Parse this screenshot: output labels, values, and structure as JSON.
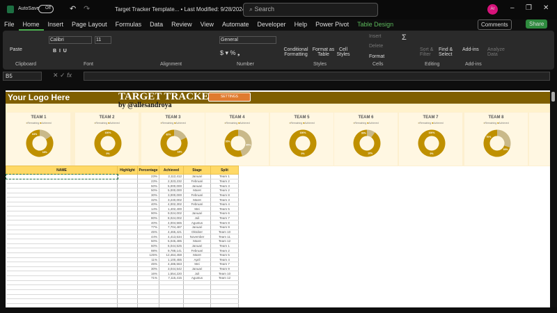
{
  "titlebar": {
    "autosave": "AutoSave",
    "toggle": "Off",
    "doc_title": "Target Tracker Template... • Last Modified: 9/28/2024",
    "search_placeholder": "Search",
    "avatar": "Ar"
  },
  "menu": [
    "File",
    "Home",
    "Insert",
    "Page Layout",
    "Formulas",
    "Data",
    "Review",
    "View",
    "Automate",
    "Developer",
    "Help",
    "Power Pivot",
    "Table Design"
  ],
  "comments": "Comments",
  "share": "Share",
  "ribbon": {
    "paste": "Paste",
    "font": "Calibri",
    "size": "11",
    "number_format": "General",
    "cond": "Conditional Formatting",
    "fmt_table": "Format as Table",
    "cell_styles": "Cell Styles",
    "insert": "Insert",
    "delete": "Delete",
    "format": "Format",
    "sort": "Sort & Filter",
    "find": "Find & Select",
    "addins": "Add-ins",
    "analyze": "Analyze Data",
    "groups": [
      "Clipboard",
      "Font",
      "Alignment",
      "Number",
      "Styles",
      "Cells",
      "Editing",
      "Add-ins"
    ]
  },
  "namebox": "B5",
  "sheet": {
    "logo": "Your Logo Here",
    "title": "TARGET TRACKER",
    "byline": "by @allesandroya",
    "settings": "SETTINGS",
    "legend_remaining": "Remaining",
    "legend_achieved": "Achieved",
    "colors": {
      "achieved": "#bf9000",
      "remaining": "#c9b98a"
    },
    "teams": [
      {
        "name": "TEAM 1",
        "remaining": 16,
        "achieved": 84
      },
      {
        "name": "TEAM 2",
        "remaining": 0,
        "achieved": 100
      },
      {
        "name": "TEAM 3",
        "remaining": 18,
        "achieved": 82
      },
      {
        "name": "TEAM 4",
        "remaining": 45,
        "achieved": 55
      },
      {
        "name": "TEAM 5",
        "remaining": 0,
        "achieved": 100
      },
      {
        "name": "TEAM 6",
        "remaining": 10,
        "achieved": 90
      },
      {
        "name": "TEAM 7",
        "remaining": 0,
        "achieved": 100
      },
      {
        "name": "TEAM 8",
        "remaining": 30,
        "achieved": 70
      }
    ],
    "headers": [
      "NAME",
      "Highlight",
      "Percentage",
      "Achieved",
      "Stage",
      "Split"
    ],
    "rows": [
      [
        "23%",
        "2,112,412",
        "Januari",
        "Team 1"
      ],
      [
        "23%",
        "2,323,232",
        "Februari",
        "Team 2"
      ],
      [
        "50%",
        "5,000,000",
        "Januari",
        "Team 3"
      ],
      [
        "50%",
        "5,000,000",
        "Maret",
        "Team 2"
      ],
      [
        "30%",
        "3,000,000",
        "Februari",
        "Team 8"
      ],
      [
        "32%",
        "3,240,002",
        "Maret",
        "Team 3"
      ],
      [
        "40%",
        "4,002,302",
        "Februari",
        "Team 4"
      ],
      [
        "14%",
        "1,402,400",
        "Mei",
        "Team 5"
      ],
      [
        "90%",
        "9,024,002",
        "Januari",
        "Team 6"
      ],
      [
        "80%",
        "8,024,002",
        "Juli",
        "Team 7"
      ],
      [
        "40%",
        "4,004,565",
        "Agustus",
        "Team 8"
      ],
      [
        "77%",
        "7,704,487",
        "Januari",
        "Team 9"
      ],
      [
        "45%",
        "4,465,421",
        "Oktober",
        "Team 10"
      ],
      [
        "44%",
        "4,413,534",
        "November",
        "Team 11"
      ],
      [
        "50%",
        "5,045,485",
        "Maret",
        "Team 12"
      ],
      [
        "60%",
        "6,044,525",
        "Januari",
        "Team 1"
      ],
      [
        "98%",
        "9,788,141",
        "Februari",
        "Team 2"
      ],
      [
        "125%",
        "12,464,458",
        "Maret",
        "Team 5"
      ],
      [
        "11%",
        "1,100,455",
        "April",
        "Team 4"
      ],
      [
        "45%",
        "4,486,563",
        "Mei",
        "Team 7"
      ],
      [
        "30%",
        "3,044,542",
        "Januari",
        "Team 9"
      ],
      [
        "16%",
        "1,554,220",
        "Juli",
        "Team 10"
      ],
      [
        "71%",
        "7,115,415",
        "Agustus",
        "Team 12"
      ]
    ]
  }
}
